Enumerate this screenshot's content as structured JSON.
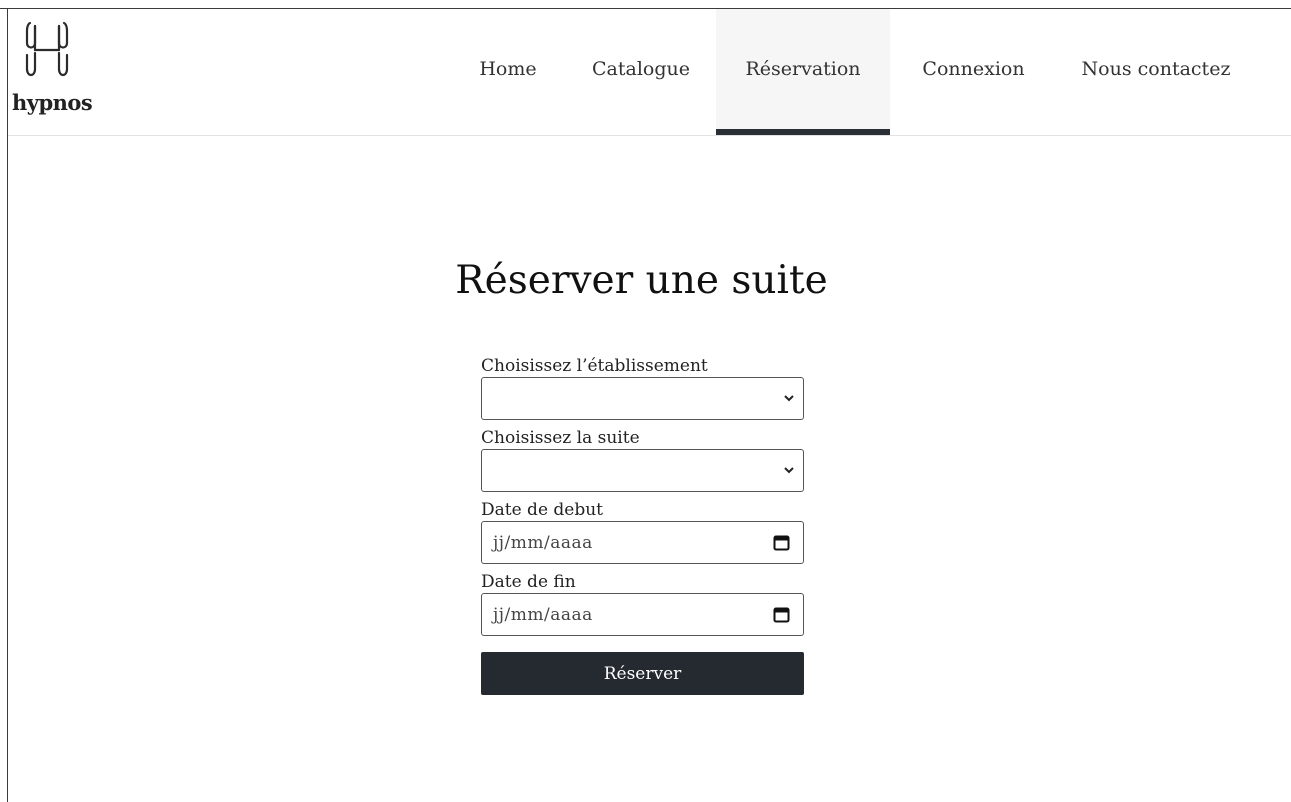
{
  "brand": {
    "name": "hypnos",
    "accent": "#252a31"
  },
  "nav": {
    "items": [
      {
        "label": "Home",
        "active": false
      },
      {
        "label": "Catalogue",
        "active": false
      },
      {
        "label": "Réservation",
        "active": true
      },
      {
        "label": "Connexion",
        "active": false
      },
      {
        "label": "Nous contactez",
        "active": false
      }
    ]
  },
  "main": {
    "title": "Réserver une suite",
    "form": {
      "establishment_label": "Choisissez l’établissement",
      "establishment_value": "",
      "suite_label": "Choisissez la suite",
      "suite_value": "",
      "start_label": "Date de debut",
      "start_placeholder": "jj/mm/aaaa",
      "end_label": "Date de fin",
      "end_placeholder": "jj/mm/aaaa",
      "submit_label": "Réserver"
    }
  },
  "icons": [
    "h-logo-icon",
    "chevron-down-icon",
    "calendar-icon"
  ]
}
